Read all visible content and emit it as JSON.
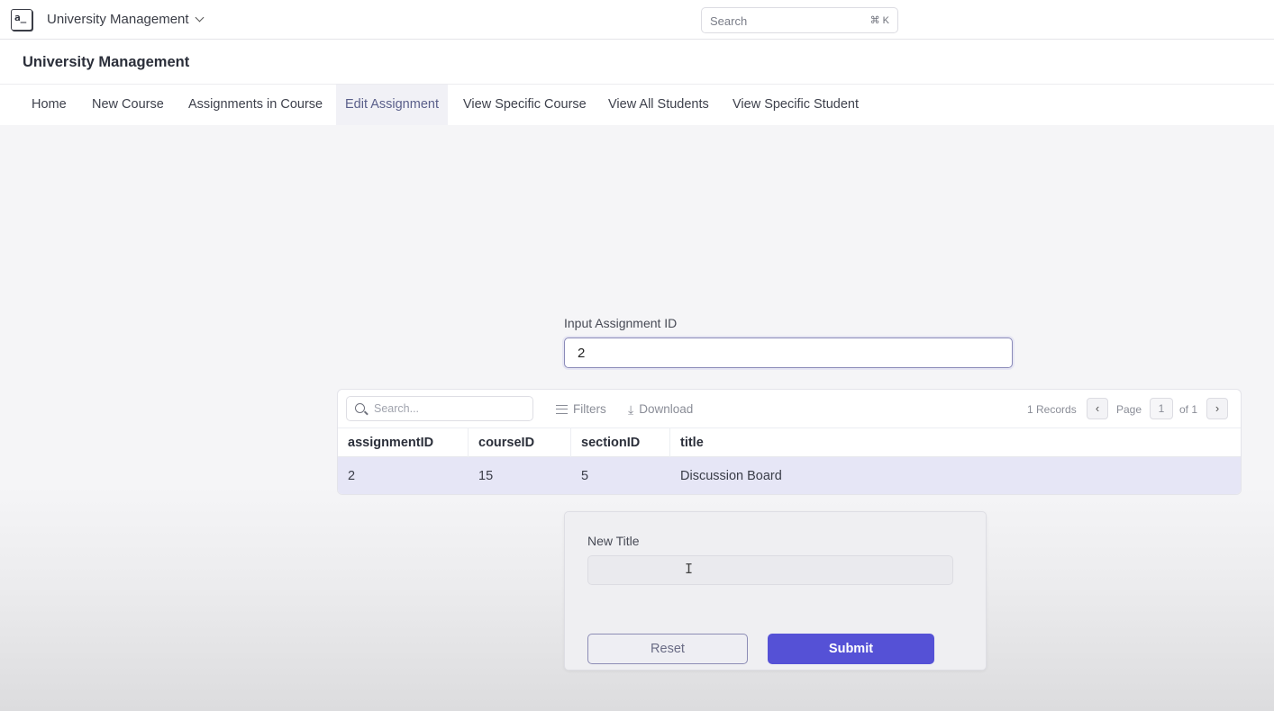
{
  "topbar": {
    "logo_text": "a_",
    "app_name": "University Management",
    "search_placeholder": "Search",
    "search_shortcut": "⌘ K"
  },
  "header": {
    "title": "University Management"
  },
  "tabs": [
    {
      "label": "Home",
      "active": false
    },
    {
      "label": "New Course",
      "active": false
    },
    {
      "label": "Assignments in Course",
      "active": false
    },
    {
      "label": "Edit Assignment",
      "active": true
    },
    {
      "label": "View Specific Course",
      "active": false
    },
    {
      "label": "View All Students",
      "active": false
    },
    {
      "label": "View Specific Student",
      "active": false
    }
  ],
  "assignment_id": {
    "label": "Input Assignment ID",
    "value": "2"
  },
  "table": {
    "search_placeholder": "Search...",
    "filters_label": "Filters",
    "download_label": "Download",
    "records": "1 Records",
    "page_label": "Page",
    "page_number": "1",
    "page_total": "of 1",
    "columns": [
      "assignmentID",
      "courseID",
      "sectionID",
      "title"
    ],
    "rows": [
      [
        "2",
        "15",
        "5",
        "Discussion Board"
      ]
    ]
  },
  "form": {
    "new_title_label": "New Title",
    "new_title_value": "",
    "reset_label": "Reset",
    "submit_label": "Submit"
  },
  "colors": {
    "accent": "#5551d6",
    "selected_row": "#e6e6f6"
  }
}
